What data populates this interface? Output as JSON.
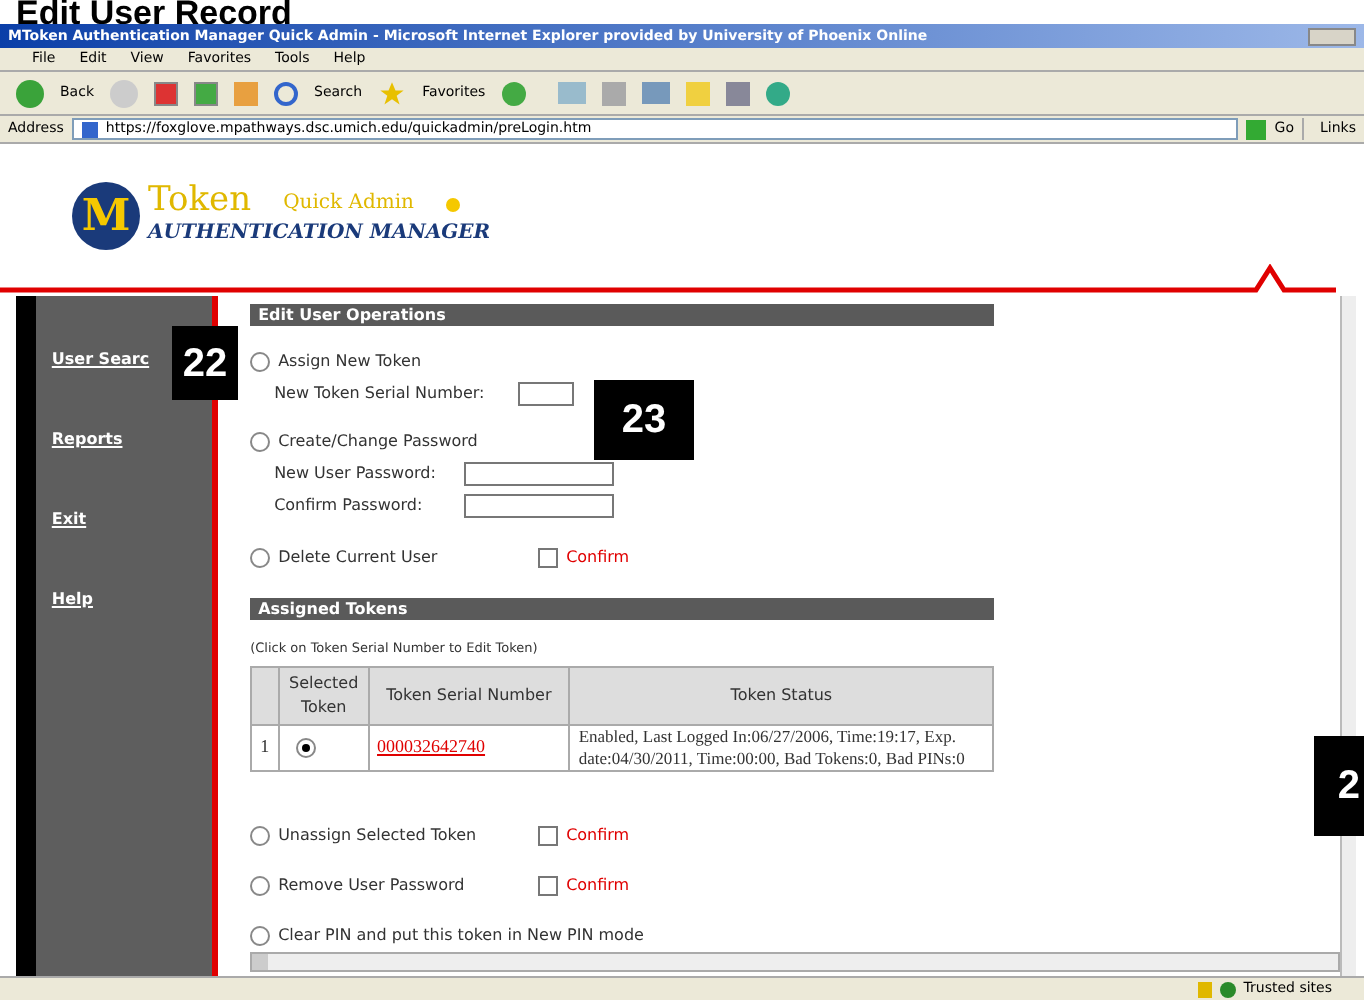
{
  "heading": "Edit User Record",
  "window": {
    "title": "MToken Authentication Manager Quick Admin - Microsoft Internet Explorer provided by University of Phoenix Online"
  },
  "menu": [
    "File",
    "Edit",
    "View",
    "Favorites",
    "Tools",
    "Help"
  ],
  "toolbar": {
    "back": "Back",
    "search": "Search",
    "favorites": "Favorites"
  },
  "address": {
    "label": "Address",
    "value": "https://foxglove.mpathways.dsc.umich.edu/quickadmin/preLogin.htm",
    "go": "Go",
    "links": "Links"
  },
  "logo": {
    "letter": "M",
    "word": "Token",
    "sub": "Quick Admin",
    "tagline": "AUTHENTICATION MANAGER"
  },
  "sidebar": {
    "items": [
      "User Searc",
      "Reports",
      "Exit",
      "Help"
    ]
  },
  "operations": {
    "title": "Edit User Operations",
    "items": [
      {
        "kind": "field",
        "label": "Assign New Token",
        "selected": false,
        "fields": [
          "New Token Serial Number:"
        ]
      },
      {
        "kind": "field",
        "label": "Create/Change Password",
        "selected": false,
        "fields": [
          "New User Password:",
          "Confirm Password:"
        ]
      },
      {
        "kind": "confirm",
        "label": "Delete Current User",
        "selected": false,
        "confirm": "Confirm",
        "checked": false
      }
    ]
  },
  "tokens": {
    "title": "Assigned Tokens",
    "hint": "(Click on Token Serial Number to Edit Token)",
    "columns": [
      "Selected Token",
      "Token Serial Number",
      "Token Status"
    ],
    "rows": [
      {
        "index": "1",
        "selected": true,
        "serial": "000032642740",
        "status": "Enabled, Last Logged In:06/27/2006, Time:19:17, Exp. date:04/30/2011, Time:00:00, Bad Tokens:0, Bad PINs:0"
      }
    ]
  },
  "actions": [
    {
      "kind": "confirm",
      "label": "Unassign Selected Token",
      "selected": false,
      "confirm": "Confirm",
      "checked": false
    },
    {
      "kind": "confirm",
      "label": "Remove User Password",
      "selected": false,
      "confirm": "Confirm",
      "checked": false
    },
    {
      "kind": "plain",
      "label": "Clear PIN and put this token in New PIN mode",
      "selected": false
    }
  ],
  "status_bar": {
    "zone": "Trusted sites"
  },
  "callouts": [
    "22",
    "23",
    "2"
  ]
}
